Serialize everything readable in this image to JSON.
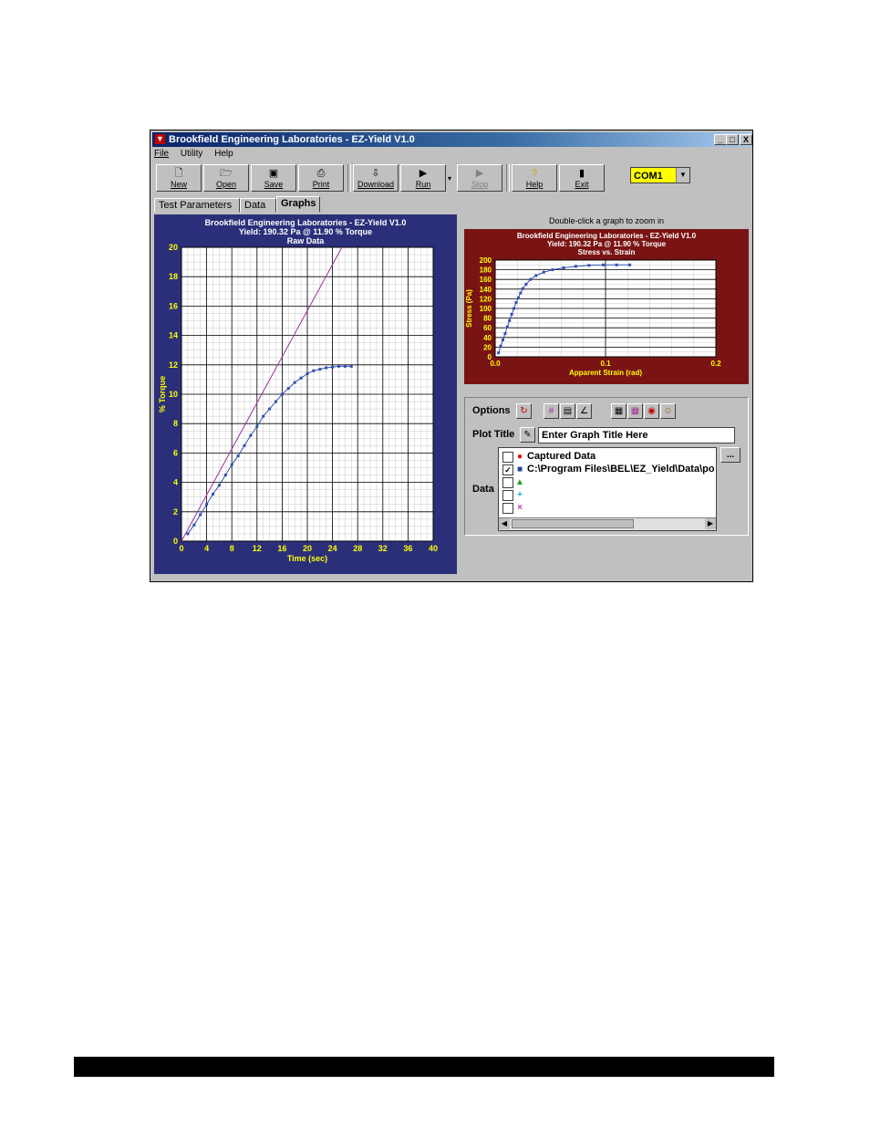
{
  "window": {
    "title": "Brookfield Engineering Laboratories  -  EZ-Yield V1.0",
    "controls": [
      "_",
      "□",
      "X"
    ]
  },
  "menu": [
    "File",
    "Utility",
    "Help"
  ],
  "toolbar": {
    "buttons": [
      {
        "label": "New",
        "icon": "new-file-icon"
      },
      {
        "label": "Open",
        "icon": "open-folder-icon"
      },
      {
        "label": "Save",
        "icon": "save-icon"
      },
      {
        "label": "Print",
        "icon": "print-icon"
      },
      {
        "label": "Download",
        "icon": "download-icon"
      },
      {
        "label": "Run",
        "icon": "run-icon"
      },
      {
        "label": "Stop",
        "icon": "stop-icon"
      },
      {
        "label": "Help",
        "icon": "help-icon"
      },
      {
        "label": "Exit",
        "icon": "exit-icon"
      }
    ],
    "port": "COM1"
  },
  "tabs": [
    "Test Parameters",
    "Data",
    "Graphs"
  ],
  "hint": "Double-click a graph to zoom in",
  "options": {
    "options_label": "Options",
    "plot_title_label": "Plot Title",
    "plot_title_value": "Enter Graph Title Here",
    "data_label": "Data",
    "more_button": "...",
    "data_rows": [
      {
        "checked": false,
        "marker": "●",
        "color": "#e00000",
        "text": "Captured Data"
      },
      {
        "checked": true,
        "marker": "■",
        "color": "#2040a0",
        "text": "C:\\Program Files\\BEL\\EZ_Yield\\Data\\po"
      },
      {
        "checked": false,
        "marker": "▲",
        "color": "#20a020",
        "text": ""
      },
      {
        "checked": false,
        "marker": "+",
        "color": "#20b0b0",
        "text": ""
      },
      {
        "checked": false,
        "marker": "×",
        "color": "#b040b0",
        "text": ""
      }
    ]
  },
  "colors": {
    "left_bg": "#2b2f7a",
    "right_bg": "#7a1414",
    "label_yellow": "#ffff00",
    "data_blue": "#3050b0",
    "tangent": "#a030a0"
  },
  "chart_data": [
    {
      "type": "scatter",
      "title": "Brookfield Engineering Laboratories  -  EZ-Yield V1.0",
      "subtitle": "Yield: 190.32 Pa @ 11.90 % Torque",
      "caption": "Raw Data",
      "xlabel": "Time (sec)",
      "ylabel": "% Torque",
      "xlim": [
        0,
        40
      ],
      "ylim": [
        0,
        20
      ],
      "xticks": [
        "0",
        "4",
        "8",
        "12",
        "16",
        "20",
        "24",
        "28",
        "32",
        "36",
        "40"
      ],
      "yticks": [
        "0",
        "2",
        "4",
        "6",
        "8",
        "10",
        "12",
        "14",
        "16",
        "18",
        "20"
      ],
      "grid": true,
      "series": [
        {
          "x": [
            1,
            2,
            3,
            4,
            5,
            6,
            7,
            8,
            9,
            10,
            11,
            12,
            13,
            14,
            15,
            16,
            17,
            18,
            19,
            20,
            21,
            22,
            23,
            24,
            25,
            26,
            27
          ],
          "y": [
            0.5,
            1.1,
            1.8,
            2.5,
            3.2,
            3.8,
            4.5,
            5.2,
            5.8,
            6.5,
            7.2,
            7.8,
            8.5,
            9.0,
            9.5,
            10.0,
            10.4,
            10.8,
            11.1,
            11.4,
            11.6,
            11.7,
            11.8,
            11.85,
            11.9,
            11.9,
            11.9
          ]
        }
      ],
      "tangent_line": {
        "x": [
          0,
          25.5
        ],
        "y": [
          0,
          20
        ]
      }
    },
    {
      "type": "scatter",
      "title": "Brookfield Engineering Laboratories  -  EZ-Yield V1.0",
      "subtitle": "Yield: 190.32 Pa @ 11.90 % Torque",
      "caption": "Stress vs. Strain",
      "xlabel": "Apparent Strain (rad)",
      "ylabel": "Stress (Pa)",
      "xlim": [
        0,
        0.2
      ],
      "ylim": [
        0,
        200
      ],
      "xticks": [
        "0.0",
        "0.1",
        "0.2"
      ],
      "yticks": [
        "0",
        "20",
        "40",
        "60",
        "80",
        "100",
        "120",
        "140",
        "160",
        "180",
        "200"
      ],
      "grid": true,
      "series": [
        {
          "x": [
            0.003,
            0.005,
            0.007,
            0.009,
            0.011,
            0.013,
            0.015,
            0.017,
            0.019,
            0.021,
            0.023,
            0.025,
            0.028,
            0.032,
            0.037,
            0.044,
            0.052,
            0.062,
            0.073,
            0.085,
            0.098,
            0.11,
            0.122
          ],
          "y": [
            8,
            22,
            35,
            48,
            62,
            75,
            88,
            100,
            112,
            122,
            132,
            141,
            150,
            160,
            168,
            175,
            180,
            184,
            187,
            189,
            190,
            190,
            190
          ]
        }
      ]
    }
  ]
}
